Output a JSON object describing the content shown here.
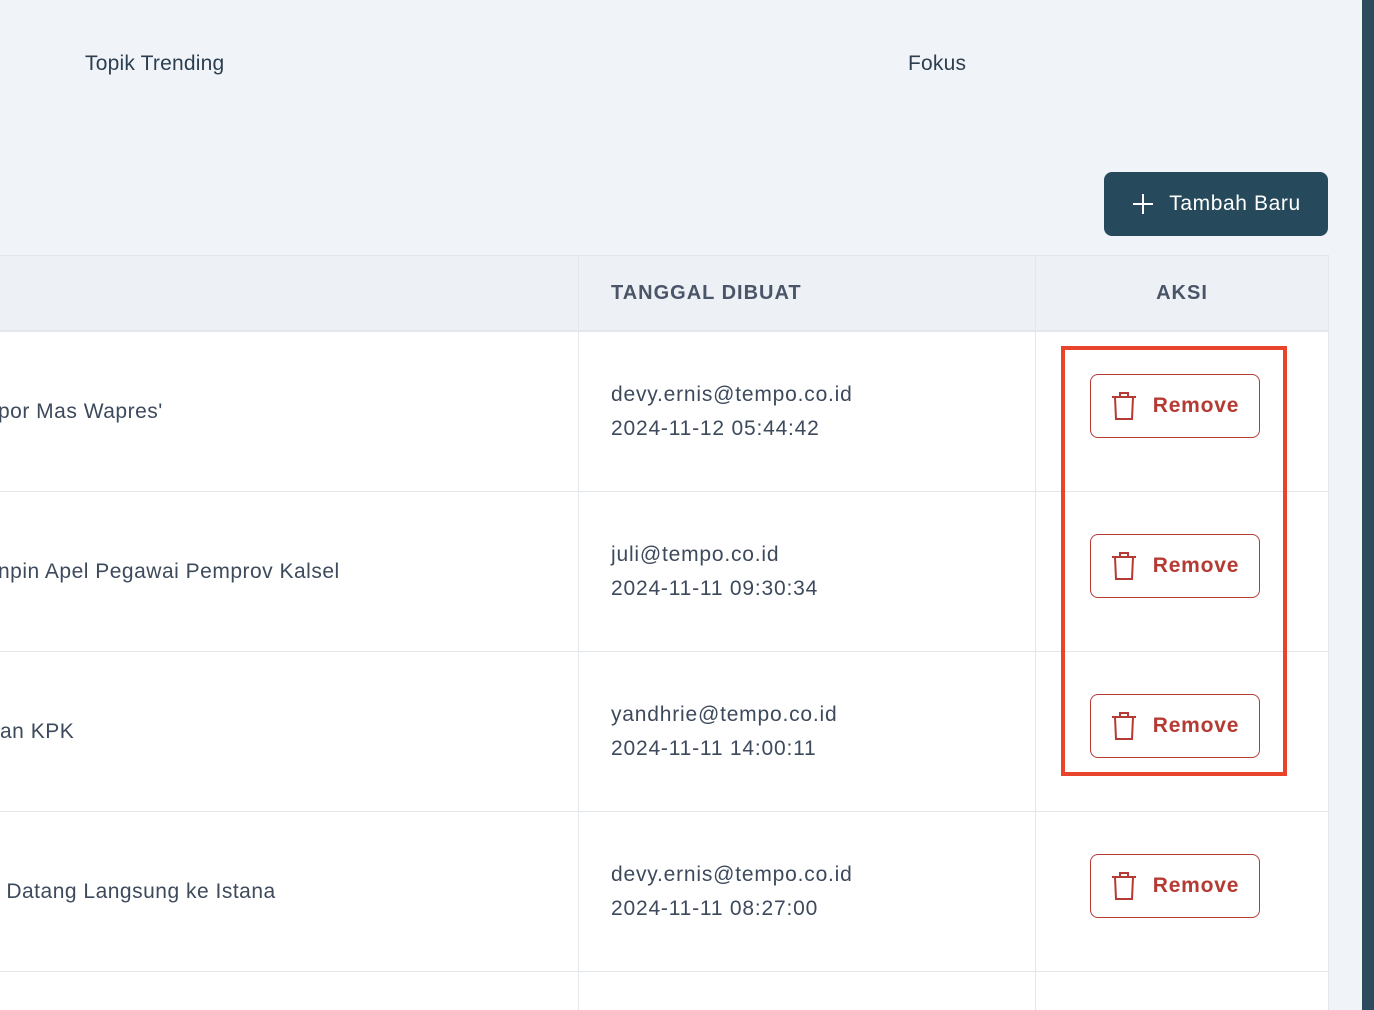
{
  "tabs": {
    "topik": "Topik Trending",
    "fokus": "Fokus"
  },
  "toolbar": {
    "add_label": "Tambah Baru"
  },
  "table": {
    "headers": {
      "tanggal": "TANGGAL DIBUAT",
      "aksi": "AKSI"
    },
    "rows": [
      {
        "title": "por Mas Wapres'",
        "creator": "devy.ernis@tempo.co.id",
        "date": "2024-11-12 05:44:42",
        "action": "Remove"
      },
      {
        "title": "npin Apel Pegawai Pemprov Kalsel",
        "creator": "juli@tempo.co.id",
        "date": "2024-11-11 09:30:34",
        "action": "Remove"
      },
      {
        "title": "an KPK",
        "creator": "yandhrie@tempo.co.id",
        "date": "2024-11-11 14:00:11",
        "action": "Remove"
      },
      {
        "title": " Datang Langsung ke Istana",
        "creator": "devy.ernis@tempo.co.id",
        "date": "2024-11-11 08:27:00",
        "action": "Remove"
      }
    ]
  },
  "colors": {
    "primary": "#264a5c",
    "danger": "#b53a34",
    "highlight": "#e8432b"
  },
  "icons": {
    "add": "plus-icon",
    "remove": "trash-icon"
  }
}
